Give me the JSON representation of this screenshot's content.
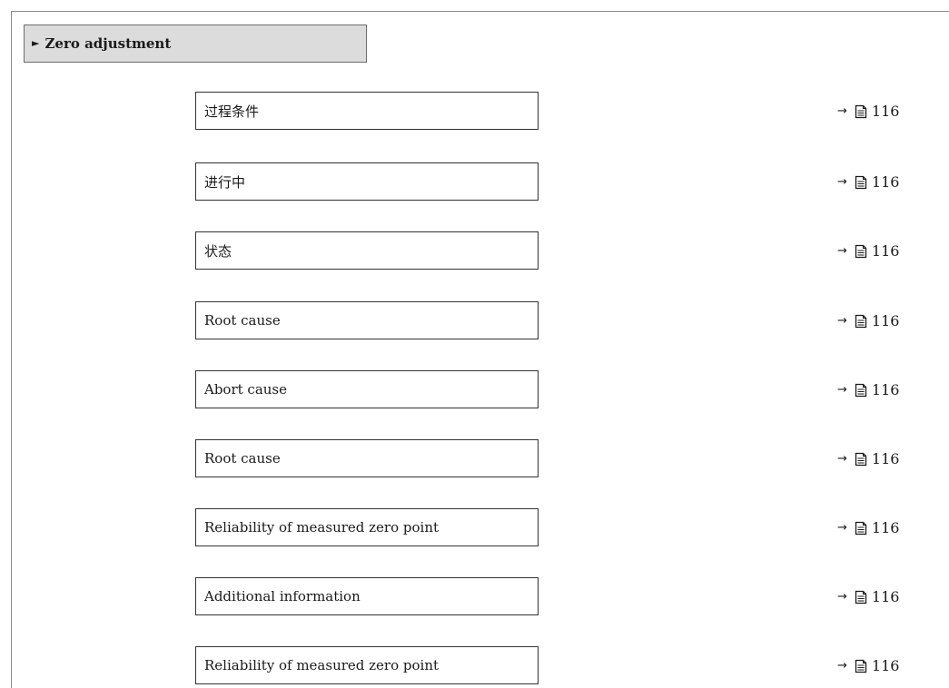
{
  "submenu": {
    "arrow": "►",
    "title": "Zero adjustment"
  },
  "reference": {
    "arrow": "→",
    "icon": "page-icon"
  },
  "parameters": [
    {
      "label": "过程条件",
      "page": "116"
    },
    {
      "label": "进行中",
      "page": "116"
    },
    {
      "label": "状态",
      "page": "116"
    },
    {
      "label": "Root cause",
      "page": "116"
    },
    {
      "label": "Abort cause",
      "page": "116"
    },
    {
      "label": "Root cause",
      "page": "116"
    },
    {
      "label": "Reliability of measured zero point",
      "page": "116"
    },
    {
      "label": "Additional information",
      "page": "116"
    },
    {
      "label": "Reliability of measured zero point",
      "page": "116"
    }
  ]
}
